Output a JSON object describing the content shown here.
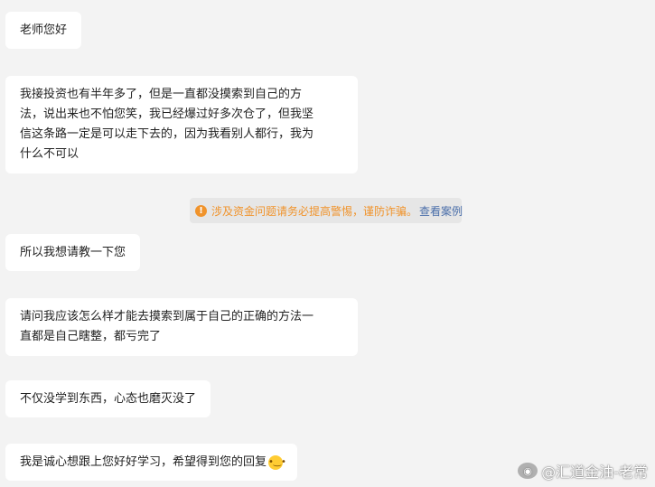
{
  "messages": [
    {
      "text": "老师您好"
    },
    {
      "lines": [
        "我接投资也有半年多了，但是一直都没摸索到自己的方",
        "法，说出来也不怕您笑，我已经爆过好多次仓了，但我坚",
        "信这条路一定是可以走下去的，因为我看别人都行，我为",
        "什么不可以"
      ]
    },
    {
      "text": "所以我想请教一下您"
    },
    {
      "lines": [
        "请问我应该怎么样才能去摸索到属于自己的正确的方法一",
        "直都是自己瞎整，都亏完了"
      ]
    },
    {
      "text": "不仅没学到东西，心态也磨灭没了"
    },
    {
      "text": "我是诚心想跟上您好好学习，希望得到您的回复",
      "emoji": "crying-face-emoji"
    }
  ],
  "system_notice": {
    "icon": "warning-icon",
    "text": "涉及资金问题请务必提高警惕，谨防诈骗。",
    "link": "查看案例"
  },
  "watermark": {
    "text": "@汇道金油-老常",
    "icon": "weibo-icon"
  },
  "colors": {
    "background": "#f3f3f3",
    "bubble": "#ffffff",
    "warning": "#f0932b",
    "link": "#4a6ea9"
  }
}
